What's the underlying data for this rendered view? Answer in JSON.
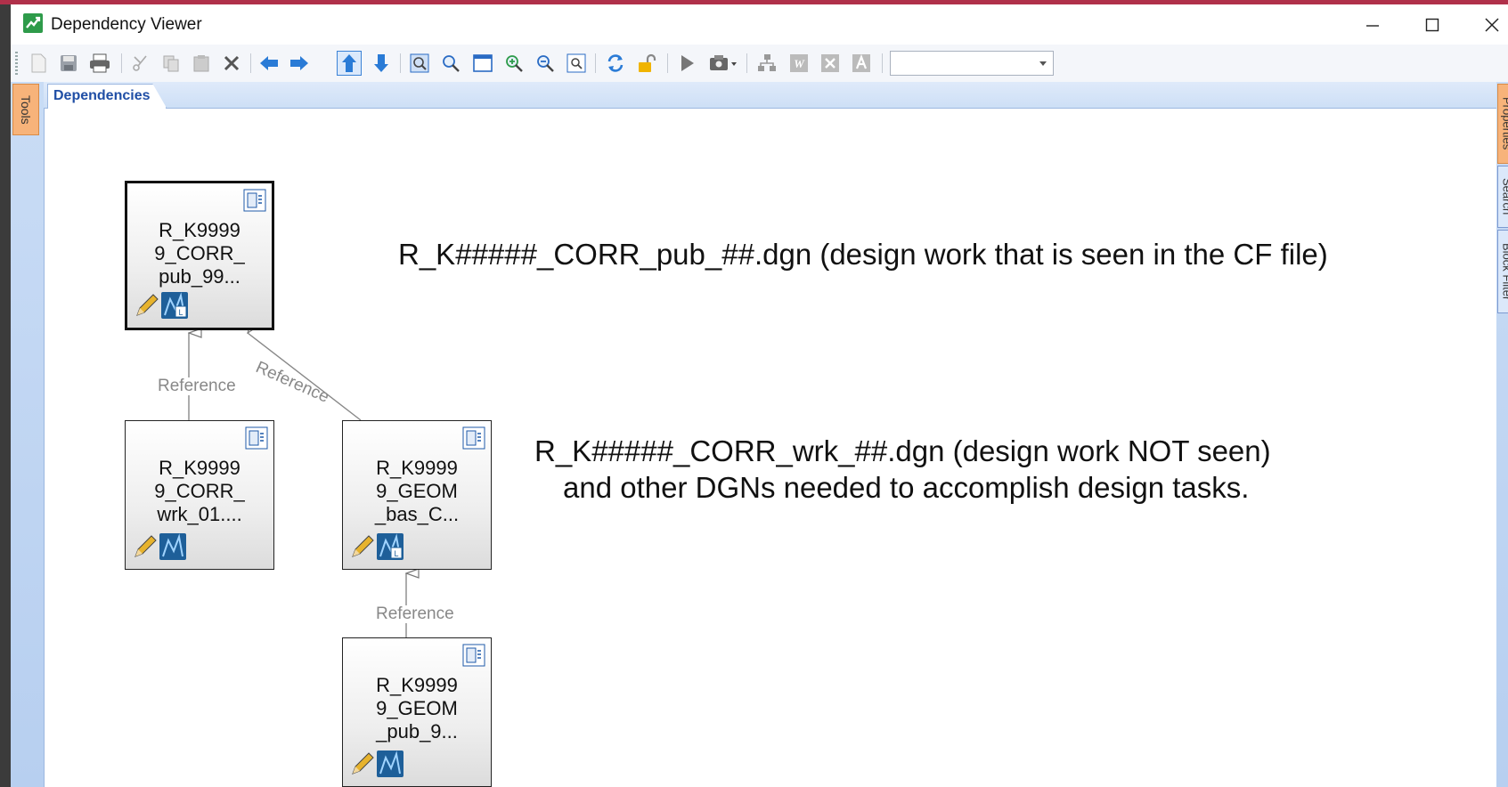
{
  "window": {
    "title": "Dependency Viewer",
    "minimize_icon": "minimize-icon",
    "maximize_icon": "maximize-icon",
    "close_icon": "close-icon"
  },
  "toolbar": {
    "buttons": [
      "new-doc-icon",
      "save-icon",
      "print-icon",
      "cut-icon",
      "copy-icon",
      "paste-icon",
      "delete-icon",
      "back-arrow-icon",
      "forward-arrow-icon",
      "up-arrow-icon",
      "down-arrow-icon",
      "fit-view-icon",
      "zoom-area-icon",
      "window-icon",
      "zoom-in-icon",
      "zoom-out-icon",
      "zoom-fit-icon",
      "refresh-icon",
      "unlock-icon",
      "play-icon",
      "export-dropdown-icon",
      "hierarchy-icon",
      "word-export-icon",
      "excel-export-icon",
      "access-export-icon"
    ],
    "dropdown_value": ""
  },
  "panels": {
    "left_tab": "Tools",
    "right_tabs": [
      "Properties",
      "Search",
      "Block Filter"
    ],
    "doc_tab": "Dependencies"
  },
  "graph": {
    "nodes": [
      {
        "id": "n1",
        "label": "R_K9999\n9_CORR_\npub_99...",
        "selected": true
      },
      {
        "id": "n2",
        "label": "R_K9999\n9_CORR_\nwrk_01....",
        "selected": false
      },
      {
        "id": "n3",
        "label": "R_K9999\n9_GEOM\n_bas_C...",
        "selected": false
      },
      {
        "id": "n4",
        "label": "R_K9999\n9_GEOM\n_pub_9...",
        "selected": false
      }
    ],
    "edges": [
      {
        "from": "n2",
        "to": "n1",
        "label": "Reference"
      },
      {
        "from": "n3",
        "to": "n1",
        "label": "Reference"
      },
      {
        "from": "n4",
        "to": "n3",
        "label": "Reference"
      }
    ]
  },
  "annotations": {
    "pub_note": "R_K#####_CORR_pub_##.dgn (design work that is seen in the CF file)",
    "wrk_note_line1": "R_K#####_CORR_wrk_##.dgn (design work NOT seen)",
    "wrk_note_line2": "and other DGNs needed to accomplish design tasks."
  }
}
